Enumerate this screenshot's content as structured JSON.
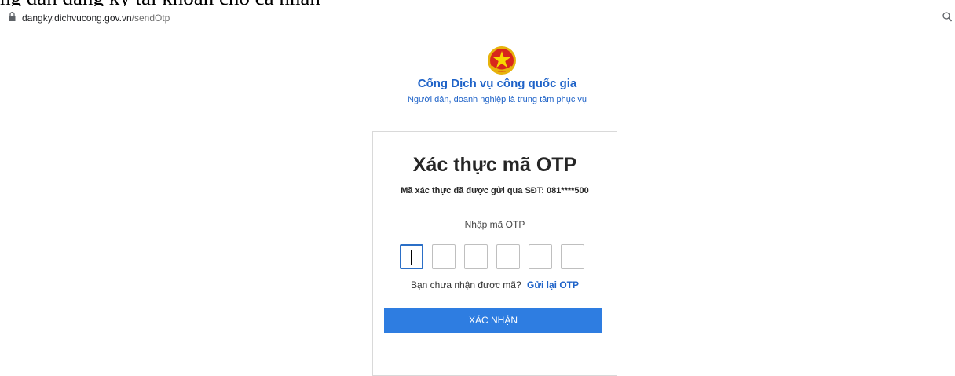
{
  "top_partial_text": "ng dẫn đăng ký tài khoản cho cá nhân",
  "browser": {
    "url_domain": "dangky.dichvucong.gov.vn",
    "url_path": "/sendOtp"
  },
  "header": {
    "title": "Cổng Dịch vụ công quốc gia",
    "subtitle": "Người dân, doanh nghiệp là trung tâm phục vụ"
  },
  "otp": {
    "title": "Xác thực mã OTP",
    "description": "Mã xác thực đã được gửi qua SĐT: 081****500",
    "input_label": "Nhập mã OTP",
    "digits": [
      "",
      "",
      "",
      "",
      "",
      ""
    ],
    "resend_prompt": "Bạn chưa nhận được mã?",
    "resend_link": "Gửi lại OTP",
    "confirm_button": "XÁC NHẬN"
  },
  "colors": {
    "brand_blue": "#1f63c8",
    "button_blue": "#2e7de1"
  },
  "icons": [
    "lock-icon",
    "zoom-icon",
    "national-emblem-icon"
  ]
}
